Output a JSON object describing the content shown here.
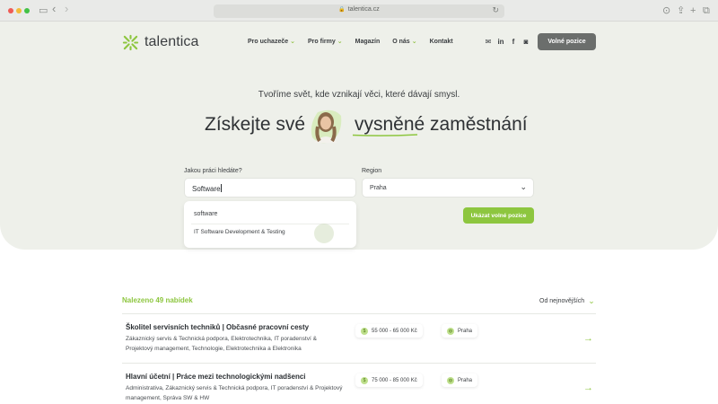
{
  "browser": {
    "url": "talentica.cz",
    "lock_icon": "lock-icon",
    "back_icon": "‹",
    "forward_icon": "›",
    "reload_icon": "↻"
  },
  "brand": {
    "name": "talentica",
    "accent": "#8dc63f",
    "dark_button": "#6b6e6c",
    "hero_bg": "#eef0ea"
  },
  "nav": {
    "items": [
      {
        "label": "Pro uchazeče",
        "has_caret": true
      },
      {
        "label": "Pro firmy",
        "has_caret": true
      },
      {
        "label": "Magazín",
        "has_caret": false
      },
      {
        "label": "O nás",
        "has_caret": true
      },
      {
        "label": "Kontakt",
        "has_caret": false
      }
    ],
    "cta": "Volné pozice",
    "socials": [
      "mail-icon",
      "linkedin-icon",
      "facebook-icon",
      "instagram-icon"
    ]
  },
  "hero": {
    "tagline": "Tvoříme svět, kde vznikají věci, které dávají smysl.",
    "headline_left": "Získejte své",
    "headline_right": "vysněné zaměstnání"
  },
  "search": {
    "job_label": "Jakou práci hledáte?",
    "job_value": "Software",
    "region_label": "Region",
    "region_value": "Praha",
    "suggestions": [
      "software",
      "IT Software Development & Testing"
    ],
    "submit": "Ukázat volné pozice"
  },
  "results": {
    "count_text": "Nalezeno 49 nabídek",
    "sort_label": "Od nejnovějších",
    "jobs": [
      {
        "title": "Školitel servisních techniků | Občasné pracovní cesty",
        "categories": "Zákaznický servis & Technická podpora, Elektrotechnika, IT poradenství & Projektový management, Technologie, Elektrotechnika a Elektronika",
        "salary": "55 000 - 65 000 Kč",
        "location": "Praha"
      },
      {
        "title": "Hlavní účetní | Práce mezi technologickými nadšenci",
        "categories": "Administrativa, Zákaznický servis & Technická podpora, IT poradenství & Projektový management, Správa SW & HW",
        "salary": "75 000 - 85 000 Kč",
        "location": "Praha"
      }
    ]
  }
}
